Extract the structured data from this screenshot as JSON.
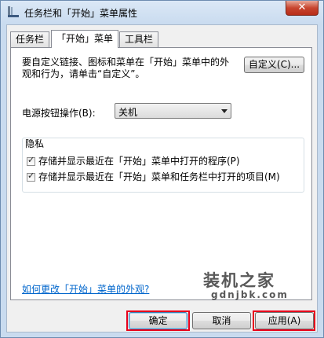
{
  "window": {
    "title": "任务栏和「开始」菜单属性",
    "close_label": "✕"
  },
  "tabs": [
    {
      "label": "任务栏"
    },
    {
      "label": "「开始」菜单"
    },
    {
      "label": "工具栏"
    }
  ],
  "panel": {
    "description": "要自定义链接、图标和菜单在「开始」菜单中的外观和行为，请单击“自定义”。",
    "customize_button": "自定义(C)...",
    "power_label": "电源按钮操作(B):",
    "power_select_value": "关机",
    "privacy_title": "隐私",
    "privacy_options": [
      {
        "label": "存储并显示最近在「开始」菜单中打开的程序(P)",
        "checked": true
      },
      {
        "label": "存储并显示最近在「开始」菜单和任务栏中打开的项目(M)",
        "checked": true
      }
    ],
    "help_link": "如何更改「开始」菜单的外观?"
  },
  "footer": {
    "ok_label": "确定",
    "cancel_label": "取消",
    "apply_label": "应用(A)"
  },
  "watermark": {
    "text": "装机之家",
    "url": "gdnjbk.com"
  },
  "colors": {
    "highlight": "#e8001c",
    "link": "#0066cc"
  }
}
